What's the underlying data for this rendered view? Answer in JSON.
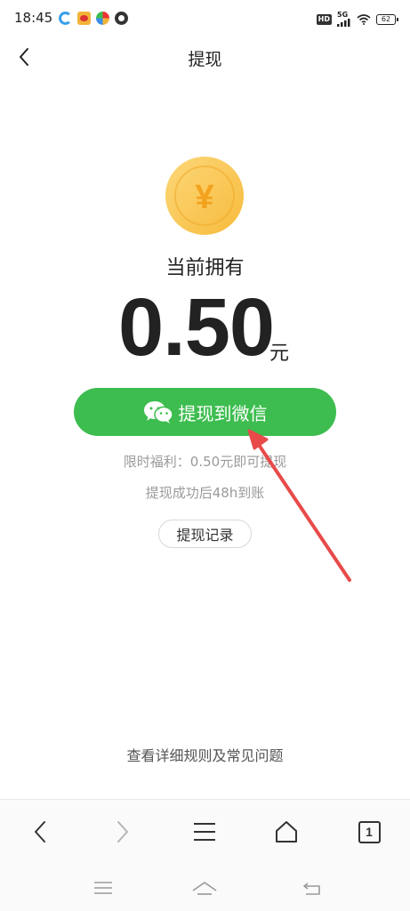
{
  "status_bar": {
    "time": "18:45",
    "hd_label": "HD",
    "network_label": "5G",
    "battery_level": "62",
    "left_icons": [
      "notification-app-icon",
      "weibo-icon",
      "app-icon",
      "app-icon"
    ]
  },
  "header": {
    "title": "提现",
    "back_icon": "chevron-left-icon"
  },
  "balance": {
    "coin_symbol": "¥",
    "label": "当前拥有",
    "amount": "0.50",
    "unit": "元"
  },
  "withdraw_button": {
    "label": "提现到微信",
    "icon": "wechat-icon",
    "color": "#3dbd4f"
  },
  "notes": {
    "promo": "限时福利：0.50元即可提现",
    "arrival": "提现成功后48h到账"
  },
  "records_button": {
    "label": "提现记录"
  },
  "rules_link": {
    "label": "查看详细规则及常见问题"
  },
  "browser_nav": {
    "tab_count": "1",
    "icons": [
      "back-icon",
      "forward-icon",
      "menu-icon",
      "home-icon",
      "tabs-icon"
    ]
  },
  "system_nav": {
    "icons": [
      "menu-icon",
      "home-icon",
      "return-icon"
    ]
  },
  "colors": {
    "accent_green": "#3dbd4f",
    "coin_gold": "#f9c74f",
    "annotation_red": "#e84a4a",
    "muted_text": "#9a9a9a"
  }
}
